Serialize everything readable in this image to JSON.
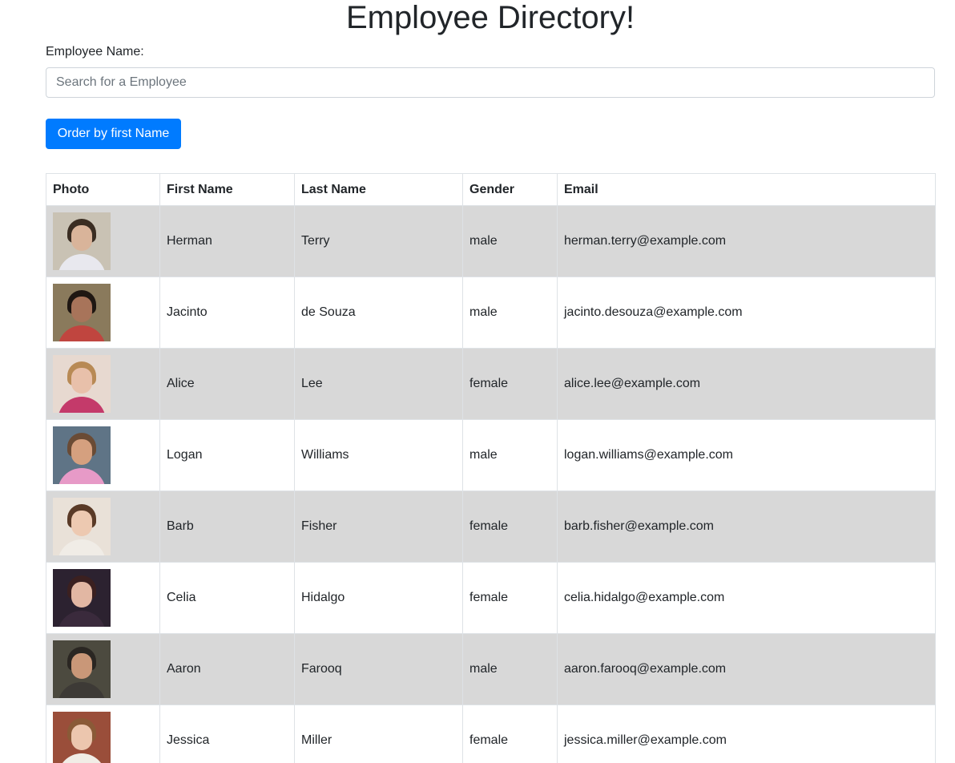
{
  "header": {
    "title": "Employee Directory!"
  },
  "search": {
    "label": "Employee Name:",
    "placeholder": "Search for a Employee",
    "value": ""
  },
  "toolbar": {
    "order_label": "Order by first Name"
  },
  "colors": {
    "accent": "#007bff",
    "row_stripe": "#d8d8d8",
    "border": "#dee2e6"
  },
  "table": {
    "headers": [
      "Photo",
      "First Name",
      "Last Name",
      "Gender",
      "Email"
    ],
    "rows": [
      {
        "first": "Herman",
        "last": "Terry",
        "gender": "male",
        "email": "herman.terry@example.com",
        "photo": "employee-photo"
      },
      {
        "first": "Jacinto",
        "last": "de Souza",
        "gender": "male",
        "email": "jacinto.desouza@example.com",
        "photo": "employee-photo"
      },
      {
        "first": "Alice",
        "last": "Lee",
        "gender": "female",
        "email": "alice.lee@example.com",
        "photo": "employee-photo"
      },
      {
        "first": "Logan",
        "last": "Williams",
        "gender": "male",
        "email": "logan.williams@example.com",
        "photo": "employee-photo"
      },
      {
        "first": "Barb",
        "last": "Fisher",
        "gender": "female",
        "email": "barb.fisher@example.com",
        "photo": "employee-photo"
      },
      {
        "first": "Celia",
        "last": "Hidalgo",
        "gender": "female",
        "email": "celia.hidalgo@example.com",
        "photo": "employee-photo"
      },
      {
        "first": "Aaron",
        "last": "Farooq",
        "gender": "male",
        "email": "aaron.farooq@example.com",
        "photo": "employee-photo"
      },
      {
        "first": "Jessica",
        "last": "Miller",
        "gender": "female",
        "email": "jessica.miller@example.com",
        "photo": "employee-photo"
      }
    ]
  }
}
